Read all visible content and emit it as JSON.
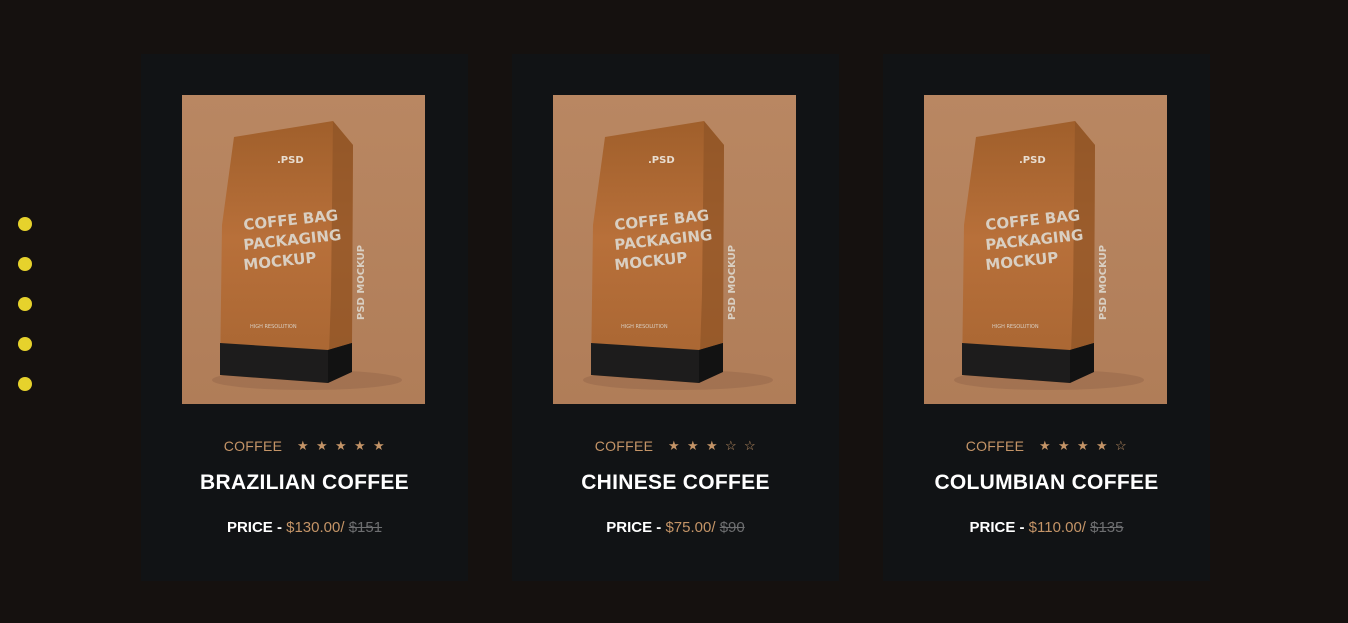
{
  "colors": {
    "background": "#15110f",
    "card": "#111315",
    "accent": "#c49467",
    "dot": "#e6d22c",
    "old_price": "#6d6e70"
  },
  "pagination": {
    "count": 5
  },
  "bag_text": {
    "badge": ".PSD",
    "line1": "COFFE BAG",
    "line2": "PACKAGING",
    "line3": "MOCKUP",
    "side": "PSD MOCKUP",
    "small": "HIGH RESOLUTION"
  },
  "products": [
    {
      "category": "COFFEE",
      "rating": 5,
      "stars": [
        "★",
        "★",
        "★",
        "★",
        "★"
      ],
      "name": "BRAZILIAN COFFEE",
      "price_label": "PRICE -",
      "price": "$130.00/",
      "old_price": "$151"
    },
    {
      "category": "COFFEE",
      "rating": 3,
      "stars": [
        "★",
        "★",
        "★",
        "☆",
        "☆"
      ],
      "name": "CHINESE COFFEE",
      "price_label": "PRICE -",
      "price": "$75.00/",
      "old_price": "$90"
    },
    {
      "category": "COFFEE",
      "rating": 4,
      "stars": [
        "★",
        "★",
        "★",
        "★",
        "☆"
      ],
      "name": "COLUMBIAN COFFEE",
      "price_label": "PRICE -",
      "price": "$110.00/",
      "old_price": "$135"
    }
  ]
}
